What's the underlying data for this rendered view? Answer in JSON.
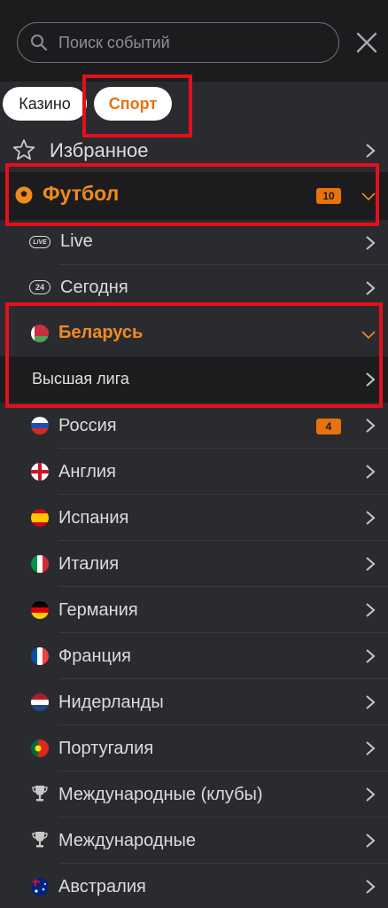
{
  "search": {
    "placeholder": "Поиск событий"
  },
  "tabs": [
    {
      "label": "Казино",
      "active": false
    },
    {
      "label": "Спорт",
      "active": true
    }
  ],
  "menu": {
    "favorites": "Избранное",
    "football": {
      "label": "Футбол",
      "badge": "10"
    },
    "live": "Live",
    "today": "Сегодня",
    "belarus": "Беларусь",
    "league": "Высшая лига",
    "countries": [
      {
        "label": "Россия",
        "flag": "russia-flag-icon",
        "badge": "4"
      },
      {
        "label": "Англия",
        "flag": "england-flag-icon"
      },
      {
        "label": "Испания",
        "flag": "spain-flag-icon"
      },
      {
        "label": "Италия",
        "flag": "italy-flag-icon"
      },
      {
        "label": "Германия",
        "flag": "germany-flag-icon"
      },
      {
        "label": "Франция",
        "flag": "france-flag-icon"
      },
      {
        "label": "Нидерланды",
        "flag": "netherlands-flag-icon"
      },
      {
        "label": "Португалия",
        "flag": "portugal-flag-icon"
      },
      {
        "label": "Международные (клубы)",
        "flag": "trophy-icon"
      },
      {
        "label": "Международные",
        "flag": "trophy-icon"
      },
      {
        "label": "Австралия",
        "flag": "australia-flag-icon"
      }
    ]
  },
  "colors": {
    "accent": "#e8720c",
    "highlight": "#e3101c",
    "background": "#2a2b2f",
    "panel": "#1c1c1e"
  },
  "icons": {
    "live": "LIVE",
    "today": "24"
  }
}
